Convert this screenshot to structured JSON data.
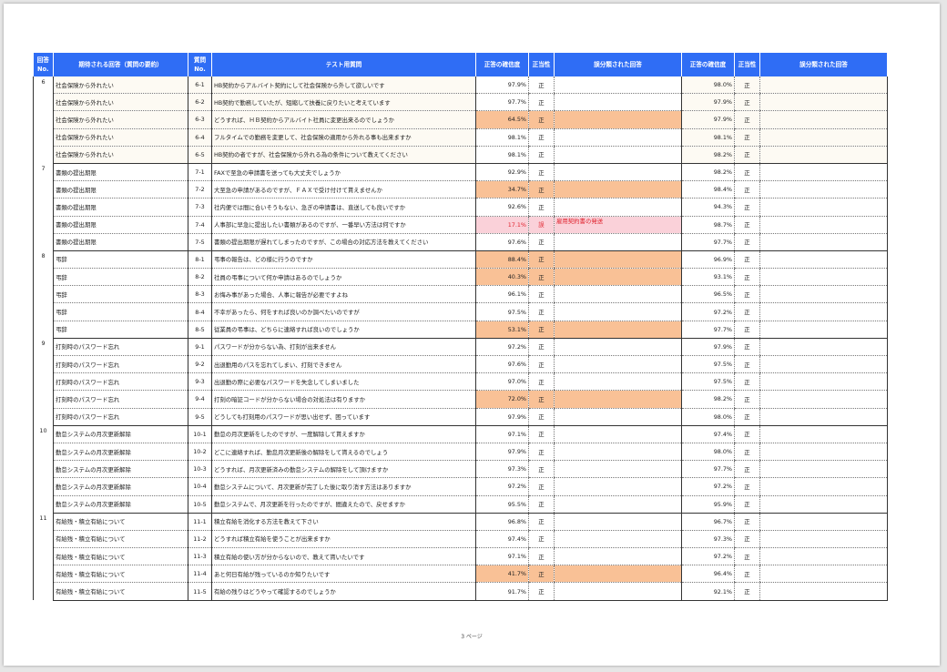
{
  "header": {
    "no": "回答\nNo.",
    "topic": "期待される回答（質問の要約）",
    "qno": "質問\nNo.",
    "question": "テスト用質問",
    "conf1": "正答の確信度",
    "correct1": "正当性",
    "mis1": "誤分類された回答",
    "conf2": "正答の確信度",
    "correct2": "正当性",
    "mis2": "誤分類された回答"
  },
  "groups": [
    {
      "no": "6",
      "rows": [
        {
          "topic": "社会保険から外れたい",
          "qno": "6-1",
          "question": "HB契約からアルバイト契約にして社会保険から外して欲しいです",
          "conf1": "97.9%",
          "correct1": "正",
          "mis1": "",
          "hl": "",
          "conf2": "98.0%",
          "correct2": "正"
        },
        {
          "topic": "社会保険から外れたい",
          "qno": "6-2",
          "question": "HB契約で勤務していたが、短縮して扶養に戻りたいと考えています",
          "conf1": "97.7%",
          "correct1": "正",
          "mis1": "",
          "hl": "",
          "conf2": "97.9%",
          "correct2": "正"
        },
        {
          "topic": "社会保険から外れたい",
          "qno": "6-3",
          "question": "どうすれば、ＨＢ契約からアルバイト社員に変更出来るのでしょうか",
          "conf1": "64.5%",
          "correct1": "正",
          "mis1": "",
          "hl": "orange",
          "conf2": "97.9%",
          "correct2": "正"
        },
        {
          "topic": "社会保険から外れたい",
          "qno": "6-4",
          "question": "フルタイムでの勤務を変更して、社会保険の適用から外れる事も出来ますか",
          "conf1": "98.1%",
          "correct1": "正",
          "mis1": "",
          "hl": "",
          "conf2": "98.1%",
          "correct2": "正"
        },
        {
          "topic": "社会保険から外れたい",
          "qno": "6-5",
          "question": "HB契約の者ですが、社会保険から外れる為の条件について教えてください",
          "conf1": "98.1%",
          "correct1": "正",
          "mis1": "",
          "hl": "",
          "conf2": "98.2%",
          "correct2": "正"
        }
      ]
    },
    {
      "no": "7",
      "rows": [
        {
          "topic": "書類の提出期限",
          "qno": "7-1",
          "question": "FAXで至急の申請書を送っても大丈夫でしょうか",
          "conf1": "92.9%",
          "correct1": "正",
          "mis1": "",
          "hl": "",
          "conf2": "98.2%",
          "correct2": "正"
        },
        {
          "topic": "書類の提出期限",
          "qno": "7-2",
          "question": "大至急の申請があるのですが、ＦＡＸで受け付けて貰えませんか",
          "conf1": "34.7%",
          "correct1": "正",
          "mis1": "",
          "hl": "orange",
          "conf2": "98.4%",
          "correct2": "正"
        },
        {
          "topic": "書類の提出期限",
          "qno": "7-3",
          "question": "社内便では間に合いそうもない、急ぎの申請書は、直送しても良いですか",
          "conf1": "92.6%",
          "correct1": "正",
          "mis1": "",
          "hl": "",
          "conf2": "94.3%",
          "correct2": "正"
        },
        {
          "topic": "書類の提出期限",
          "qno": "7-4",
          "question": "人事部に早急に提出したい書類があるのですが、一番早い方法は何ですか",
          "conf1": "17.1%",
          "correct1": "誤",
          "mis1": "雇用契約書の発送",
          "hl": "pink",
          "conf2": "98.7%",
          "correct2": "正"
        },
        {
          "topic": "書類の提出期限",
          "qno": "7-5",
          "question": "書類の提出期限が遅れてしまったのですが、この場合の対応方法を教えてください",
          "conf1": "97.6%",
          "correct1": "正",
          "mis1": "",
          "hl": "",
          "conf2": "97.7%",
          "correct2": "正"
        }
      ]
    },
    {
      "no": "8",
      "rows": [
        {
          "topic": "弔辞",
          "qno": "8-1",
          "question": "弔事の報告は、どの様に行うのですか",
          "conf1": "88.4%",
          "correct1": "正",
          "mis1": "",
          "hl": "orange",
          "conf2": "96.9%",
          "correct2": "正"
        },
        {
          "topic": "弔辞",
          "qno": "8-2",
          "question": "社員の弔事について何か申請はあるのでしょうか",
          "conf1": "40.3%",
          "correct1": "正",
          "mis1": "",
          "hl": "orange",
          "conf2": "93.1%",
          "correct2": "正"
        },
        {
          "topic": "弔辞",
          "qno": "8-3",
          "question": "お悔み事があった場合、人事に報告が必要ですよね",
          "conf1": "96.1%",
          "correct1": "正",
          "mis1": "",
          "hl": "",
          "conf2": "96.5%",
          "correct2": "正"
        },
        {
          "topic": "弔辞",
          "qno": "8-4",
          "question": "不幸があったら、何をすれば良いのか調べたいのですが",
          "conf1": "97.5%",
          "correct1": "正",
          "mis1": "",
          "hl": "",
          "conf2": "97.2%",
          "correct2": "正"
        },
        {
          "topic": "弔辞",
          "qno": "8-5",
          "question": "従業員の弔事は、どちらに連絡すれば良いのでしょうか",
          "conf1": "53.1%",
          "correct1": "正",
          "mis1": "",
          "hl": "orange",
          "conf2": "97.7%",
          "correct2": "正"
        }
      ]
    },
    {
      "no": "9",
      "rows": [
        {
          "topic": "打刻時のパスワード忘れ",
          "qno": "9-1",
          "question": "パスワードが分からない為、打刻が出来ません",
          "conf1": "97.2%",
          "correct1": "正",
          "mis1": "",
          "hl": "",
          "conf2": "97.9%",
          "correct2": "正"
        },
        {
          "topic": "打刻時のパスワード忘れ",
          "qno": "9-2",
          "question": "出退勤用のパスを忘れてしまい、打刻できません",
          "conf1": "97.6%",
          "correct1": "正",
          "mis1": "",
          "hl": "",
          "conf2": "97.5%",
          "correct2": "正"
        },
        {
          "topic": "打刻時のパスワード忘れ",
          "qno": "9-3",
          "question": "出退勤の際に必要なパスワードを失念してしまいました",
          "conf1": "97.0%",
          "correct1": "正",
          "mis1": "",
          "hl": "",
          "conf2": "97.5%",
          "correct2": "正"
        },
        {
          "topic": "打刻時のパスワード忘れ",
          "qno": "9-4",
          "question": "打刻の暗証コードが分からない場合の対処法は有りますか",
          "conf1": "72.0%",
          "correct1": "正",
          "mis1": "",
          "hl": "orange",
          "conf2": "98.2%",
          "correct2": "正"
        },
        {
          "topic": "打刻時のパスワード忘れ",
          "qno": "9-5",
          "question": "どうしても打刻用のパスワードが思い出せず、困っています",
          "conf1": "97.9%",
          "correct1": "正",
          "mis1": "",
          "hl": "",
          "conf2": "98.0%",
          "correct2": "正"
        }
      ]
    },
    {
      "no": "10",
      "rows": [
        {
          "topic": "勤怠システムの月次更新解除",
          "qno": "10-1",
          "question": "勤怠の月次更新をしたのですが、一度解除して貰えますか",
          "conf1": "97.1%",
          "correct1": "正",
          "mis1": "",
          "hl": "",
          "conf2": "97.4%",
          "correct2": "正"
        },
        {
          "topic": "勤怠システムの月次更新解除",
          "qno": "10-2",
          "question": "どこに連絡すれば、勤怠月次更新後の解除をして貰えるのでしょう",
          "conf1": "97.9%",
          "correct1": "正",
          "mis1": "",
          "hl": "",
          "conf2": "98.0%",
          "correct2": "正"
        },
        {
          "topic": "勤怠システムの月次更新解除",
          "qno": "10-3",
          "question": "どうすれば、月次更新済みの勤怠システムの解除をして頂けますか",
          "conf1": "97.3%",
          "correct1": "正",
          "mis1": "",
          "hl": "",
          "conf2": "97.7%",
          "correct2": "正"
        },
        {
          "topic": "勤怠システムの月次更新解除",
          "qno": "10-4",
          "question": "勤怠システムについて、月次更新が完了した後に取り消す方法はありますか",
          "conf1": "97.2%",
          "correct1": "正",
          "mis1": "",
          "hl": "",
          "conf2": "97.2%",
          "correct2": "正"
        },
        {
          "topic": "勤怠システムの月次更新解除",
          "qno": "10-5",
          "question": "勤怠システムで、月次更新を行ったのですが、間違えたので、戻せますか",
          "conf1": "95.5%",
          "correct1": "正",
          "mis1": "",
          "hl": "",
          "conf2": "95.9%",
          "correct2": "正"
        }
      ]
    },
    {
      "no": "11",
      "rows": [
        {
          "topic": "有給残・積立有給について",
          "qno": "11-1",
          "question": "積立有給を消化する方法を教えて下さい",
          "conf1": "96.8%",
          "correct1": "正",
          "mis1": "",
          "hl": "",
          "conf2": "96.7%",
          "correct2": "正"
        },
        {
          "topic": "有給残・積立有給について",
          "qno": "11-2",
          "question": "どうすれば積立有給を使うことが出来ますか",
          "conf1": "97.4%",
          "correct1": "正",
          "mis1": "",
          "hl": "",
          "conf2": "97.3%",
          "correct2": "正"
        },
        {
          "topic": "有給残・積立有給について",
          "qno": "11-3",
          "question": "積立有給の使い方が分からないので、教えて貰いたいです",
          "conf1": "97.1%",
          "correct1": "正",
          "mis1": "",
          "hl": "",
          "conf2": "97.2%",
          "correct2": "正"
        },
        {
          "topic": "有給残・積立有給について",
          "qno": "11-4",
          "question": "あと何日有給が残っているのか知りたいです",
          "conf1": "41.7%",
          "correct1": "正",
          "mis1": "",
          "hl": "orange",
          "conf2": "96.4%",
          "correct2": "正"
        },
        {
          "topic": "有給残・積立有給について",
          "qno": "11-5",
          "question": "有給の残りはどうやって確認するのでしょうか",
          "conf1": "91.7%",
          "correct1": "正",
          "mis1": "",
          "hl": "",
          "conf2": "92.1%",
          "correct2": "正"
        }
      ]
    }
  ],
  "footer": "3 ページ"
}
